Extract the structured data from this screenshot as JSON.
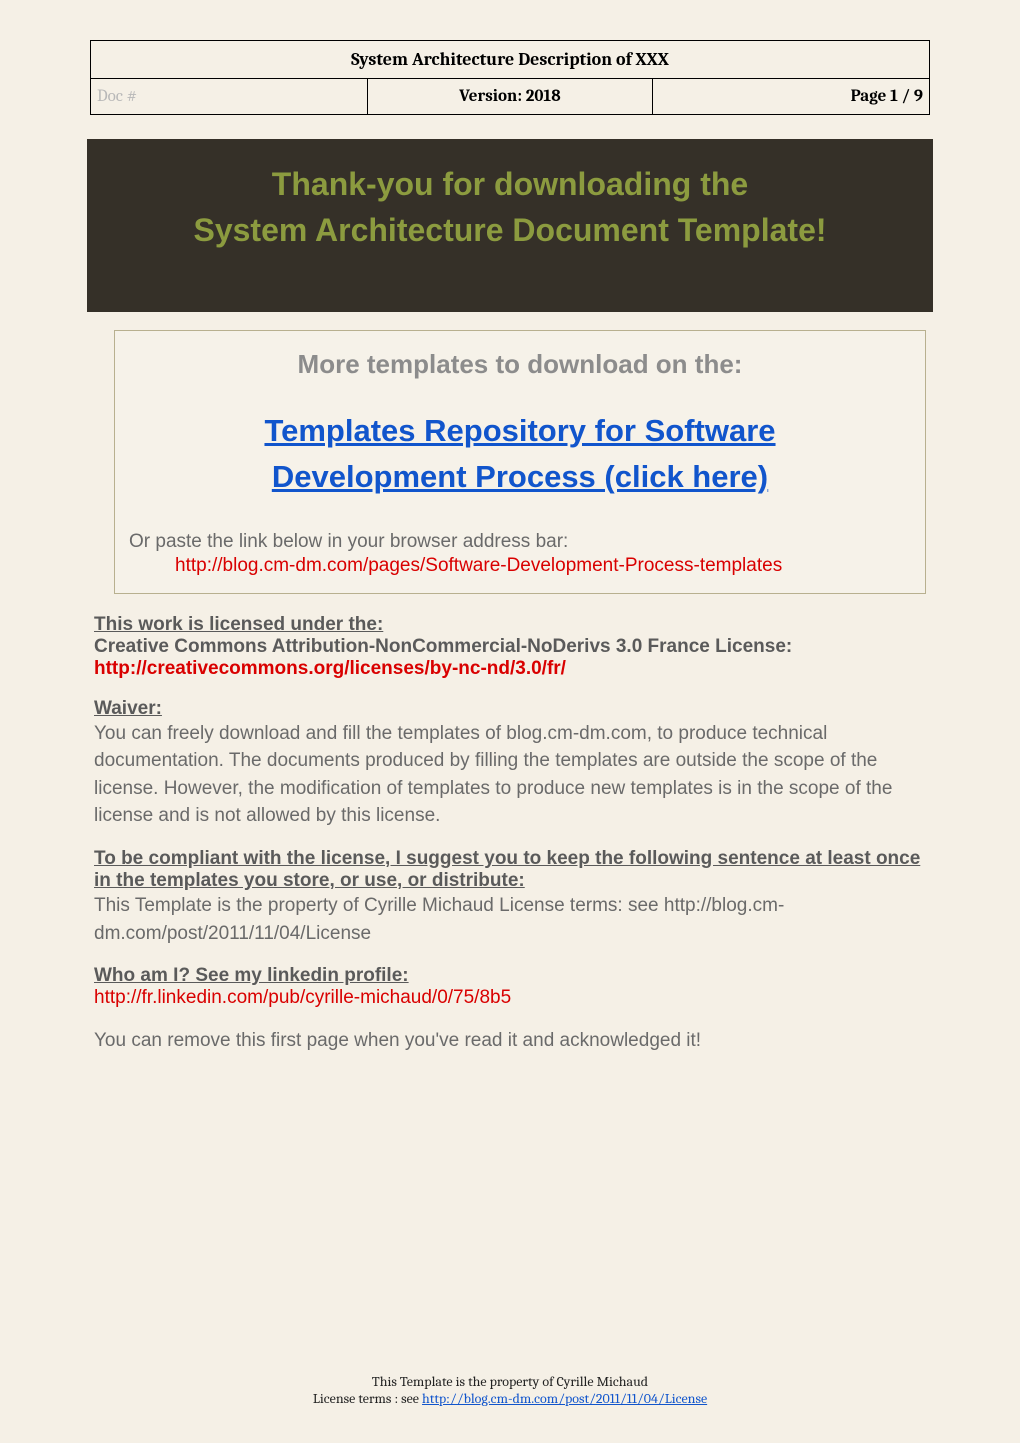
{
  "header": {
    "title": "System Architecture Description of XXX",
    "doc": "Doc #",
    "version": "Version: 2018",
    "page": "Page 1 / 9"
  },
  "banner": {
    "line1": "Thank-you for downloading the",
    "line2": "System Architecture Document Template!"
  },
  "box": {
    "more": "More templates to download on the:",
    "repo_line1": "Templates Repository for Software",
    "repo_line2": "Development Process (click here)",
    "paste_label": "Or paste the link below in your browser address bar:",
    "paste_url": "http://blog.cm-dm.com/pages/Software-Development-Process-templates"
  },
  "license": {
    "heading": "This work is licensed under the:",
    "name": "Creative Commons Attribution-NonCommercial-NoDerivs 3.0 France License:",
    "url": "http://creativecommons.org/licenses/by-nc-nd/3.0/fr/"
  },
  "waiver": {
    "heading": "Waiver:",
    "text": "You can freely download and fill the templates of blog.cm-dm.com, to produce technical documentation. The documents produced by filling the templates are outside the scope of the license. However, the modification of templates to produce new templates is in the scope of the license and is not allowed by this license."
  },
  "compliance": {
    "heading": "To be compliant with the license, I suggest you to keep the following sentence at least once in the templates you store, or use, or distribute:",
    "text": "This Template is the property of Cyrille Michaud License terms: see http://blog.cm-dm.com/post/2011/11/04/License"
  },
  "who": {
    "heading": "Who am I? See my linkedin profile:",
    "url": "http://fr.linkedin.com/pub/cyrille-michaud/0/75/8b5"
  },
  "remove_note": "You can remove this first page when you've read it and acknowledged it!",
  "footer": {
    "line1": "This Template is the property of Cyrille Michaud",
    "line2_prefix": "License terms : see ",
    "line2_link": "http://blog.cm-dm.com/post/2011/11/04/License"
  }
}
